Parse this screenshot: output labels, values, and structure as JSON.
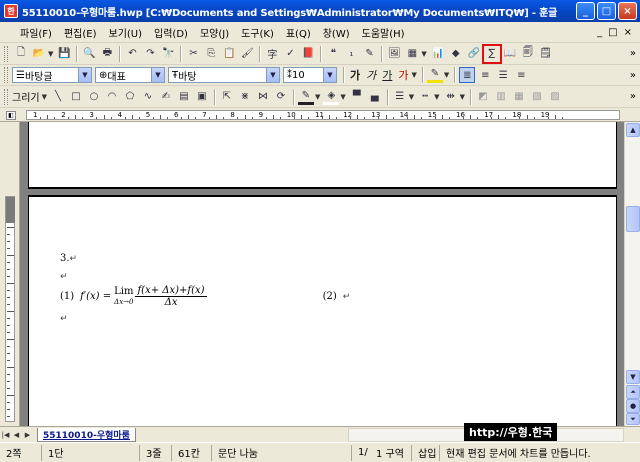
{
  "window": {
    "app_icon_label": "한",
    "title": "55110010-우형마룸.hwp [C:₩Documents and Settings₩Administrator₩My Documents₩ITQ₩] - 훈글",
    "minimize_label": "_",
    "maximize_label": "□",
    "close_label": "×"
  },
  "menu": {
    "items": [
      "파일(F)",
      "편집(E)",
      "보기(U)",
      "입력(D)",
      "모양(J)",
      "도구(K)",
      "표(Q)",
      "창(W)",
      "도움말(H)"
    ],
    "mdi_buttons": [
      "_",
      "□",
      "×"
    ]
  },
  "format_bar": {
    "style": "바탕글",
    "font_lang": "대표",
    "font": "바탕",
    "size": "10"
  },
  "draw_bar": {
    "label": "그리기"
  },
  "ruler": {
    "corner": "◧",
    "numbers": [
      "1",
      "2",
      "3",
      "4",
      "5",
      "6",
      "7",
      "8",
      "9",
      "10",
      "11",
      "12",
      "13",
      "14",
      "15",
      "16",
      "17",
      "18",
      "19"
    ]
  },
  "document": {
    "question_number": "3.",
    "para_mark": "↵",
    "formula_part1": "(1)",
    "formula_lhs": "f′(x) =",
    "lim_text": "Lim",
    "lim_sub": "Δx→0",
    "frac_numerator": "f(x+ Δx)+f(x)",
    "frac_denominator": "Δx",
    "formula_part2": "(2)"
  },
  "tabbar": {
    "doc_tab": "55110010-우형마룸"
  },
  "status": {
    "page": "2쪽",
    "column": "1단",
    "line": "3줄",
    "char": "61칸",
    "section_break": "문단 나눔",
    "section_count": "1/",
    "section": "1 구역",
    "insert_mode": "삽입",
    "message": "현재 편집 문서에 차트를 만듭니다."
  },
  "watermark": "http://우형.한국",
  "colors": {
    "titlebar": "#0646c5",
    "chrome": "#ece9d8",
    "highlight": "#e01010",
    "workspace": "#808080"
  }
}
